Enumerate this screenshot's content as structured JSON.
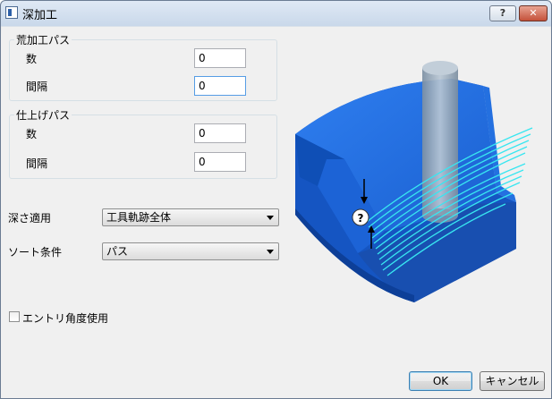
{
  "window": {
    "title": "深加工",
    "help_label": "?",
    "close_label": "✕"
  },
  "rough_group": {
    "title": "荒加工パス",
    "count_label": "数",
    "count_value": "0",
    "interval_label": "間隔",
    "interval_value": "0"
  },
  "finish_group": {
    "title": "仕上げパス",
    "count_label": "数",
    "count_value": "0",
    "interval_label": "間隔",
    "interval_value": "0"
  },
  "depth_apply": {
    "label": "深さ適用",
    "selected": "工具軌跡全体"
  },
  "sort_condition": {
    "label": "ソート条件",
    "selected": "パス"
  },
  "entry_angle": {
    "label": "エントリ角度使用",
    "checked": false
  },
  "buttons": {
    "ok": "OK",
    "cancel": "キャンセル"
  },
  "illustration": {
    "help_marker": "?"
  },
  "colors": {
    "block": "#1c63d6",
    "toolpath": "#38e6f0",
    "tool": "#8ea3b6"
  }
}
